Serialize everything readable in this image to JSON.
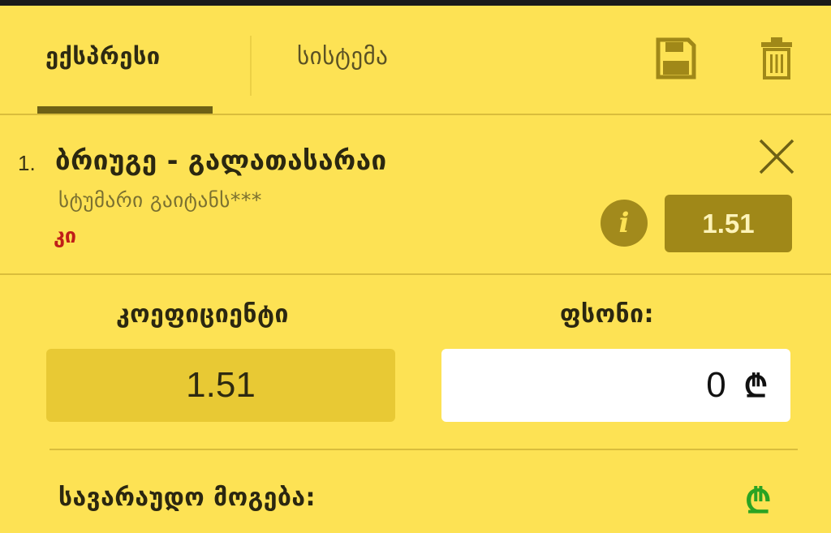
{
  "tabs": {
    "express": "ექსპრესი",
    "system": "სისტემა"
  },
  "toolbar": {
    "save_icon": "floppy-disk",
    "trash_icon": "trash-can"
  },
  "bet": {
    "index": "1.",
    "match": "ბრიუგე - გალათასარაი",
    "selection": "სტუმარი გაიტანს***",
    "status": "კი",
    "odd": "1.51"
  },
  "form": {
    "coefficient_label": "კოეფიციენტი",
    "coefficient_value": "1.51",
    "stake_label": "ფსონი:",
    "stake_value": "0",
    "currency_symbol": "₾"
  },
  "potential_win": {
    "label": "სავარაუდო მოგება:",
    "currency_symbol": "₾"
  },
  "colors": {
    "background": "#fde254",
    "accent_dark": "#a08818",
    "status_red": "#c01e18",
    "win_green": "#2aa323"
  }
}
